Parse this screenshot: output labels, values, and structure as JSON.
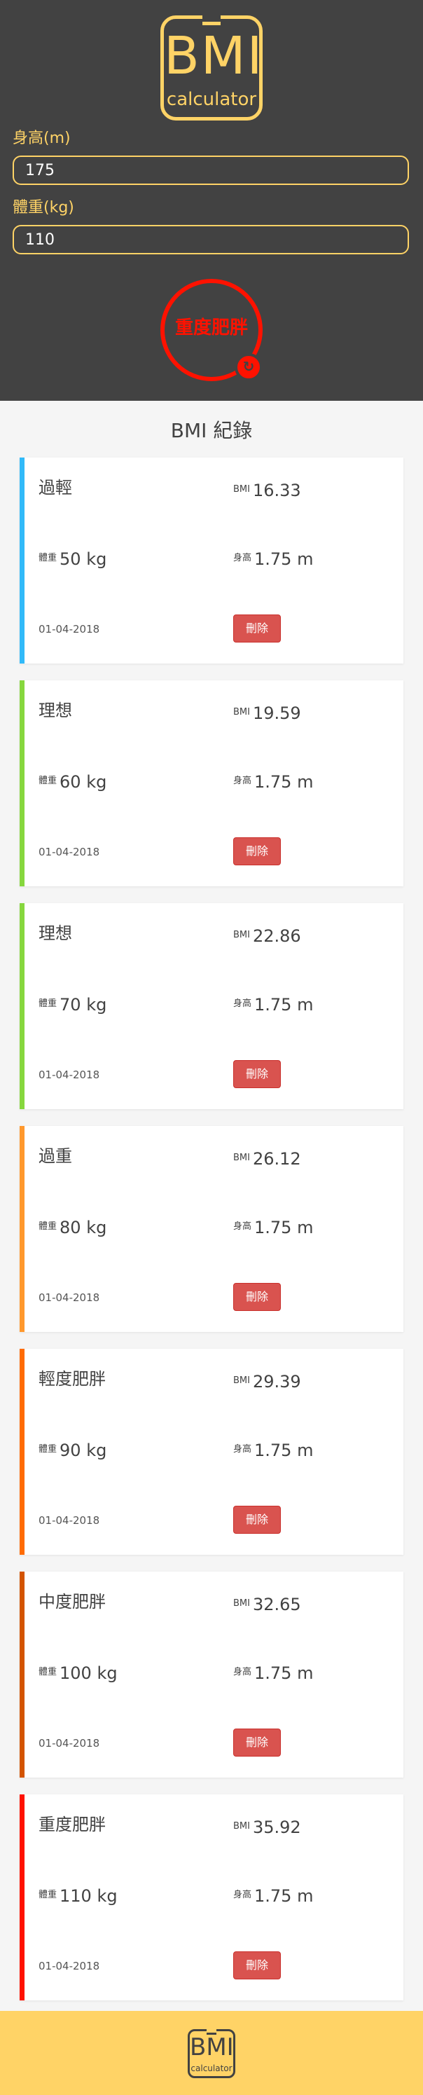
{
  "logo": {
    "main": "BMI",
    "sub": "calculator"
  },
  "form": {
    "height_label": "身高(m)",
    "height_value": "175",
    "weight_label": "體重(kg)",
    "weight_value": "110"
  },
  "result": {
    "status": "重度肥胖",
    "reset_icon": "refresh-icon",
    "color": "#ff1200"
  },
  "records_title": "BMI 紀錄",
  "records": [
    {
      "status": "過輕",
      "bmi_label": "BMI",
      "bmi": "16.33",
      "weight_label": "體重",
      "weight": "50",
      "weight_unit": "kg",
      "height_label": "身高",
      "height": "1.75",
      "height_unit": "m",
      "date": "01-04-2018",
      "delete_label": "刪除",
      "color": "#31baf9"
    },
    {
      "status": "理想",
      "bmi_label": "BMI",
      "bmi": "19.59",
      "weight_label": "體重",
      "weight": "60",
      "weight_unit": "kg",
      "height_label": "身高",
      "height": "1.75",
      "height_unit": "m",
      "date": "01-04-2018",
      "delete_label": "刪除",
      "color": "#86d73e"
    },
    {
      "status": "理想",
      "bmi_label": "BMI",
      "bmi": "22.86",
      "weight_label": "體重",
      "weight": "70",
      "weight_unit": "kg",
      "height_label": "身高",
      "height": "1.75",
      "height_unit": "m",
      "date": "01-04-2018",
      "delete_label": "刪除",
      "color": "#86d73e"
    },
    {
      "status": "過重",
      "bmi_label": "BMI",
      "bmi": "26.12",
      "weight_label": "體重",
      "weight": "80",
      "weight_unit": "kg",
      "height_label": "身高",
      "height": "1.75",
      "height_unit": "m",
      "date": "01-04-2018",
      "delete_label": "刪除",
      "color": "#ff982d"
    },
    {
      "status": "輕度肥胖",
      "bmi_label": "BMI",
      "bmi": "29.39",
      "weight_label": "體重",
      "weight": "90",
      "weight_unit": "kg",
      "height_label": "身高",
      "height": "1.75",
      "height_unit": "m",
      "date": "01-04-2018",
      "delete_label": "刪除",
      "color": "#ff6c03"
    },
    {
      "status": "中度肥胖",
      "bmi_label": "BMI",
      "bmi": "32.65",
      "weight_label": "體重",
      "weight": "100",
      "weight_unit": "kg",
      "height_label": "身高",
      "height": "1.75",
      "height_unit": "m",
      "date": "01-04-2018",
      "delete_label": "刪除",
      "color": "#d35400"
    },
    {
      "status": "重度肥胖",
      "bmi_label": "BMI",
      "bmi": "35.92",
      "weight_label": "體重",
      "weight": "110",
      "weight_unit": "kg",
      "height_label": "身高",
      "height": "1.75",
      "height_unit": "m",
      "date": "01-04-2018",
      "delete_label": "刪除",
      "color": "#ff1200"
    }
  ],
  "footer_logo": {
    "main": "BMI",
    "sub": "calculator"
  },
  "colors": {
    "header_bg": "#424242",
    "accent": "#ffd366",
    "delete": "#d9534f"
  }
}
